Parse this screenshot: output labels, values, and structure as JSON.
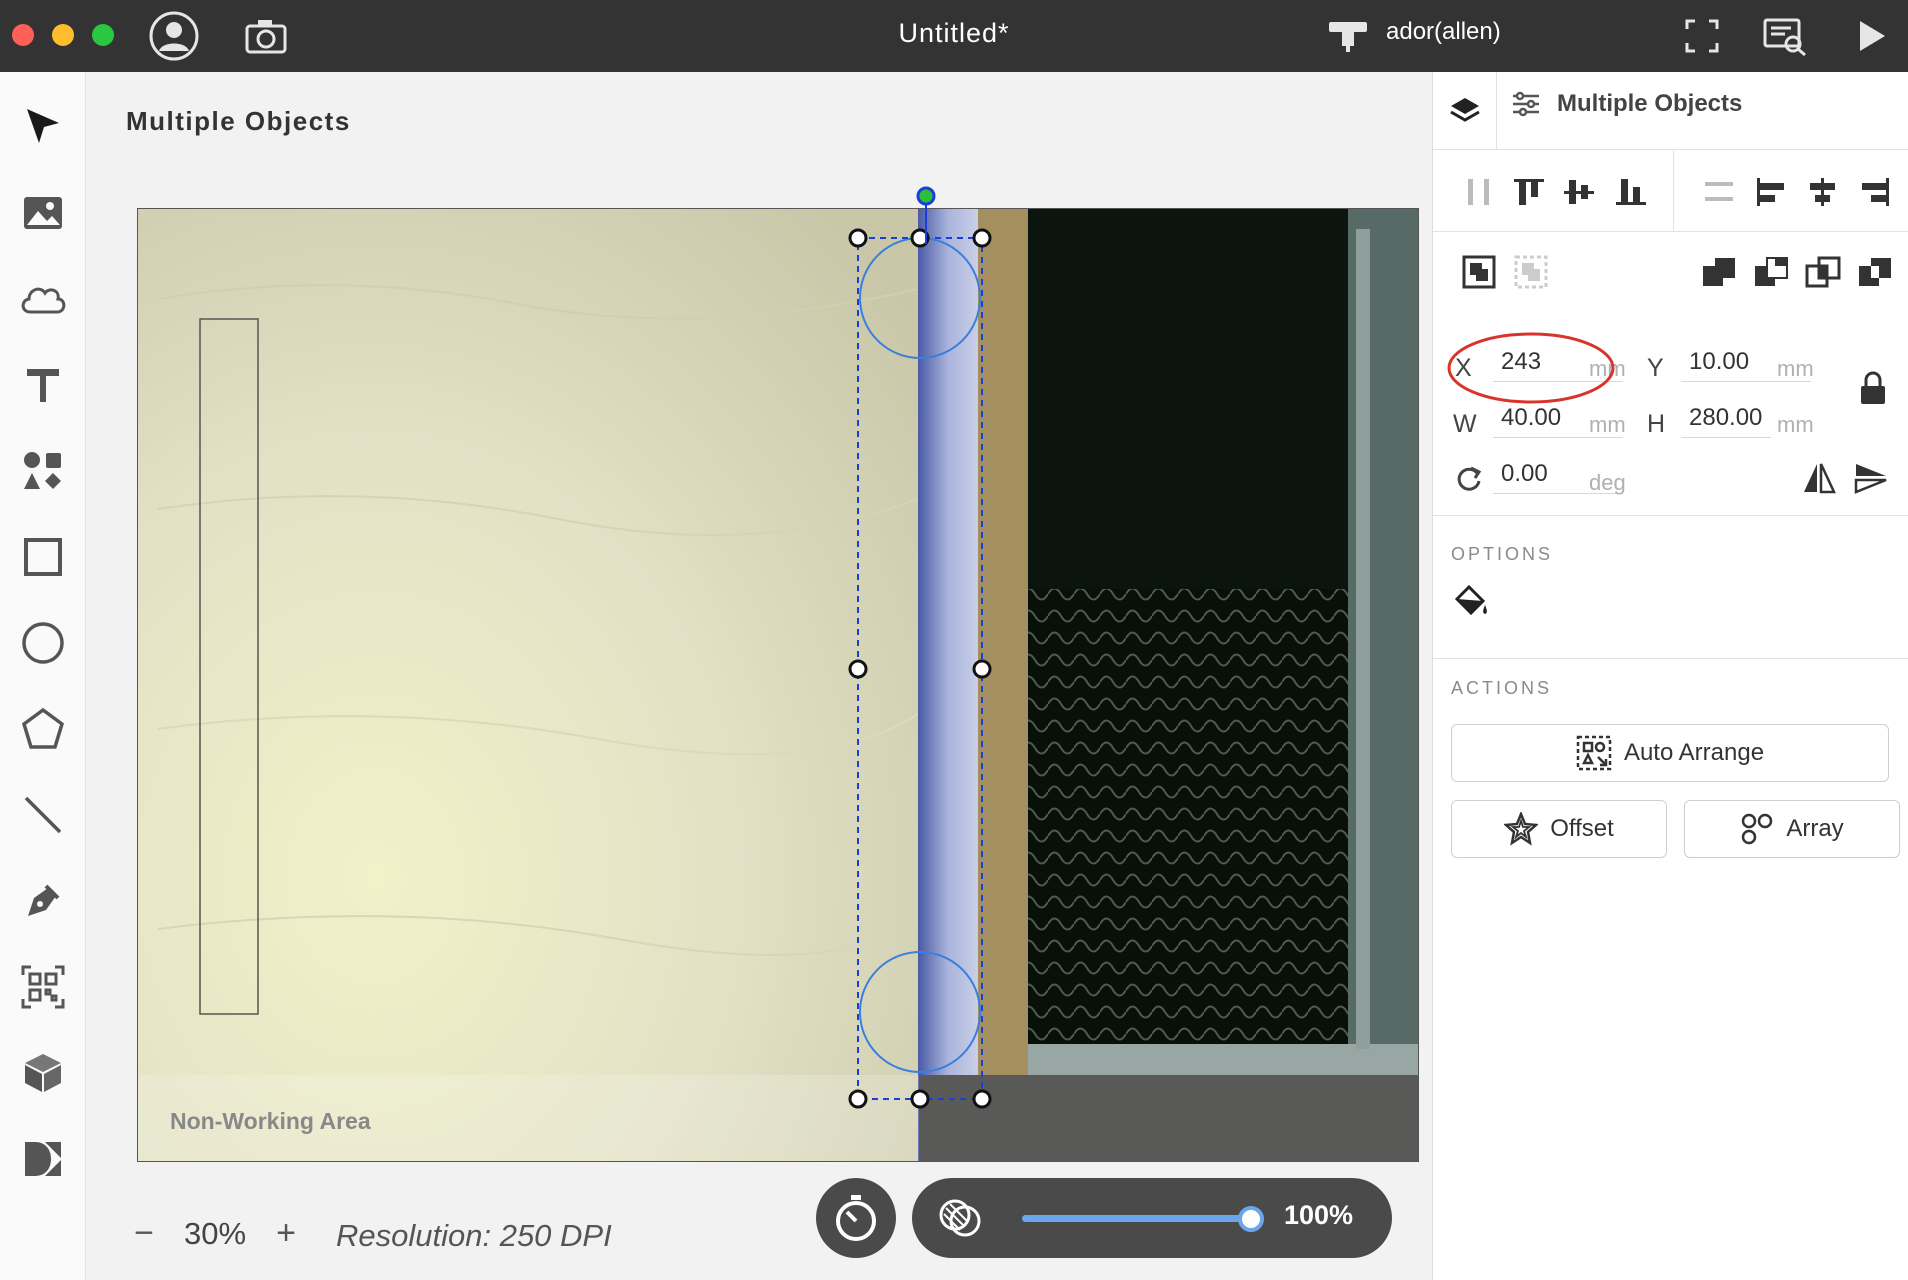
{
  "window": {
    "title": "Untitled*",
    "device": "ador(allen)",
    "traffic_lights": [
      "#ff5f57",
      "#febc2e",
      "#28c840"
    ]
  },
  "left_toolbar": {
    "tools": [
      "select-arrow-icon",
      "image-icon",
      "cloud-icon",
      "text-icon",
      "elements-icon",
      "rectangle-icon",
      "ellipse-icon",
      "polygon-icon",
      "line-icon",
      "pen-icon",
      "qr-code-icon",
      "box-icon",
      "dmkt-icon"
    ]
  },
  "canvas": {
    "title": "Multiple Objects",
    "non_working_area": "Non-Working Area",
    "zoom_minus": "−",
    "zoom_value": "30%",
    "zoom_plus": "+",
    "resolution": "Resolution: 250 DPI",
    "camera_opacity": "100%",
    "camera_opacity_fraction": 1.0
  },
  "panel": {
    "title": "Multiple Objects",
    "position": {
      "x_label": "X",
      "x_value": "243",
      "x_unit": "mm",
      "y_label": "Y",
      "y_value": "10.00",
      "y_unit": "mm",
      "w_label": "W",
      "w_value": "40.00",
      "w_unit": "mm",
      "h_label": "H",
      "h_value": "280.00",
      "h_unit": "mm",
      "rotation_value": "0.00",
      "rotation_unit": "deg"
    },
    "options_title": "OPTIONS",
    "actions_title": "ACTIONS",
    "actions": {
      "auto_arrange": "Auto Arrange",
      "offset": "Offset",
      "array": "Array"
    }
  },
  "colors": {
    "titlebar": "#333333",
    "selection": "#1a3fd8",
    "highlight_circle": "#d9342b",
    "slider": "#6aa6ea"
  }
}
